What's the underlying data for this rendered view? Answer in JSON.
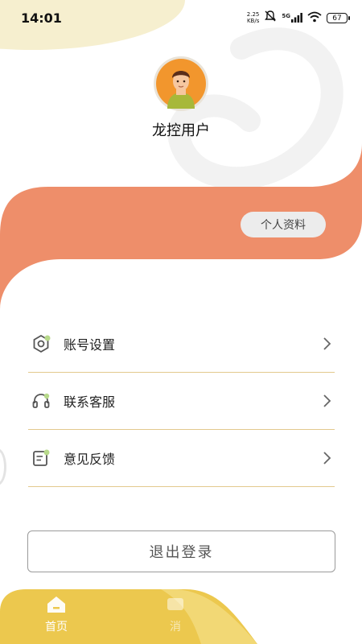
{
  "status_bar": {
    "time": "14:01",
    "net_speed_value": "2.25",
    "net_speed_unit": "KB/s",
    "network_label": "5G",
    "battery": "67"
  },
  "profile": {
    "username": "龙控用户",
    "profile_button_label": "个人资料"
  },
  "menu": {
    "items": [
      {
        "label": "账号设置",
        "icon": "settings-icon"
      },
      {
        "label": "联系客服",
        "icon": "headset-icon"
      },
      {
        "label": "意见反馈",
        "icon": "feedback-icon"
      }
    ]
  },
  "logout_label": "退出登录",
  "tab_bar": {
    "tabs": [
      {
        "label": "首页",
        "icon": "home-icon"
      },
      {
        "label": "消",
        "icon": "message-icon"
      }
    ]
  },
  "colors": {
    "accent_orange": "#ee8e6a",
    "divider_gold": "#e3c98d",
    "tab_bar_yellow": "#ecc84e",
    "corner_cream": "#f6efcf"
  }
}
